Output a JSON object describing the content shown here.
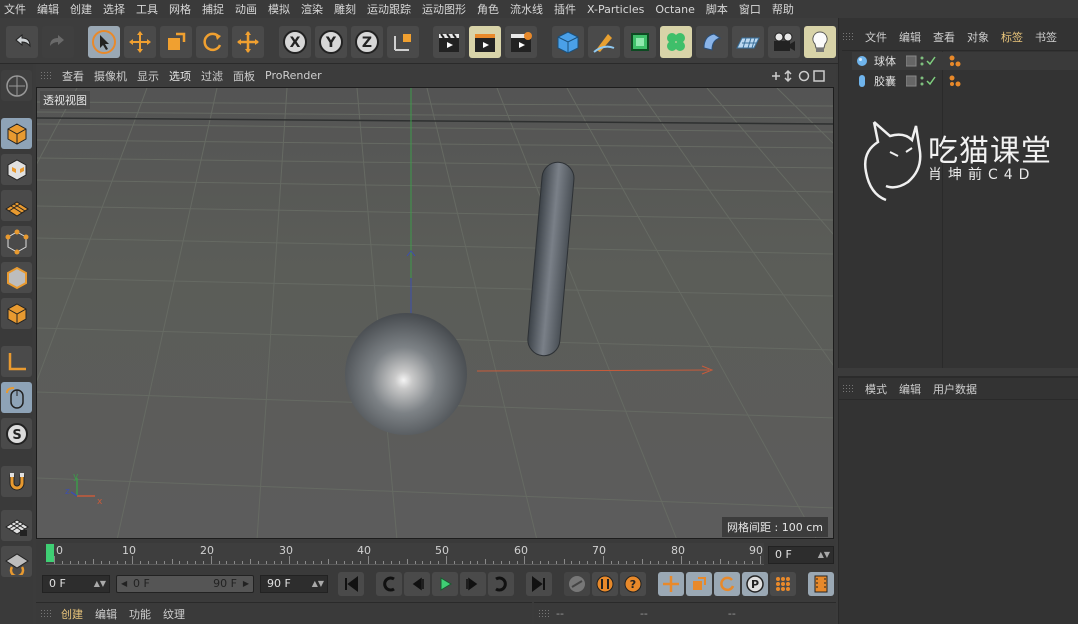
{
  "menubar": [
    "文件",
    "编辑",
    "创建",
    "选择",
    "工具",
    "网格",
    "捕捉",
    "动画",
    "模拟",
    "渲染",
    "雕刻",
    "运动跟踪",
    "运动图形",
    "角色",
    "流水线",
    "插件",
    "X-Particles",
    "Octane",
    "脚本",
    "窗口",
    "帮助"
  ],
  "viewport": {
    "menu": [
      "查看",
      "摄像机",
      "显示",
      "选项",
      "过滤",
      "面板",
      "ProRender"
    ],
    "label": "透视视图",
    "grid_spacing": "网格间距 : 100 cm",
    "axes": {
      "x": "x",
      "y": "y",
      "z": "z"
    }
  },
  "object_manager": {
    "menu": [
      "文件",
      "编辑",
      "查看",
      "对象",
      "标签",
      "书签"
    ],
    "active_menu": "标签",
    "objects": [
      {
        "name": "球体",
        "icon": "sphere-icon"
      },
      {
        "name": "胶囊",
        "icon": "capsule-icon"
      }
    ]
  },
  "attribute_manager": {
    "menu": [
      "模式",
      "编辑",
      "用户数据"
    ]
  },
  "logo": {
    "title": "吃猫课堂",
    "subtitle": "肖坤前C4D"
  },
  "timeline": {
    "ticks": [
      "0",
      "10",
      "20",
      "30",
      "40",
      "50",
      "60",
      "70",
      "80",
      "90"
    ],
    "current_frame": 0,
    "end_field": "0 F",
    "start_field": "0 F",
    "range_start": "0 F",
    "range_end": "90 F",
    "max_field": "90 F"
  },
  "material_manager": {
    "menu": [
      "创建",
      "编辑",
      "功能",
      "纹理"
    ]
  },
  "coord_manager": {
    "labels": [
      "--",
      "--",
      "--"
    ]
  },
  "colors": {
    "accent_orange": "#e8892a",
    "play_green": "#3fcf74",
    "active_tab": "#e8c47a"
  }
}
